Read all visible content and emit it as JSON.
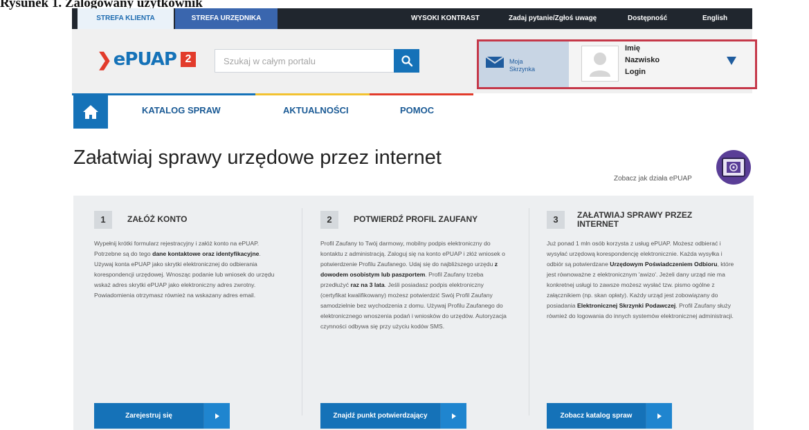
{
  "caption": "Rysunek 1. Zalogowany użytkownik",
  "topbar": {
    "tab_client": "STREFA KLIENTA",
    "tab_official": "STREFA URZĘDNIKA",
    "links": [
      "WYSOKI KONTRAST",
      "Zadaj pytanie/Zgłoś uwagę",
      "Dostępność",
      "English"
    ]
  },
  "header": {
    "logo_text": "ePUAP",
    "logo_badge": "2",
    "search_placeholder": "Szukaj w całym portalu",
    "mailbox_label_1": "Moja",
    "mailbox_label_2": "Skrzynka",
    "user_first": "Imię",
    "user_last": "Nazwisko",
    "user_login": "Login"
  },
  "nav": {
    "items": [
      "KATALOG SPRAW",
      "AKTUALNOŚCI",
      "POMOC"
    ]
  },
  "main": {
    "title": "Załatwiaj sprawy urzędowe przez internet",
    "how_link": "Zobacz jak działa ePUAP"
  },
  "steps": [
    {
      "number": "1",
      "title": "ZAŁÓŻ KONTO",
      "body_1": "Wypełnij krótki formularz rejestracyjny i załóż konto na ePUAP. Potrzebne są do tego ",
      "body_bold_1": "dane kontaktowe oraz identyfikacyjne",
      "body_2": ". Używaj konta ePUAP jako skrytki elektronicznej do odbierania korespondencji urzędowej. Wnosząc podanie lub wniosek do urzędu wskaż adres skrytki ePUAP jako elektroniczny adres zwrotny. Powiadomienia otrzymasz również na wskazany adres email.",
      "button": "Zarejestruj się"
    },
    {
      "number": "2",
      "title": "POTWIERDŹ PROFIL ZAUFANY",
      "body_1": "Profil Zaufany to Twój darmowy, mobilny podpis elektroniczny do kontaktu z administracją. Zaloguj się na konto ePUAP i złóż wniosek o potwierdzenie Profilu Zaufanego. Udaj się do najbliższego urzędu ",
      "body_bold_1": "z dowodem osobistym lub paszportem",
      "body_2": ". Profil Zaufany trzeba przedłużyć ",
      "body_bold_2": "raz na 3 lata",
      "body_3": ". Jeśli posiadasz podpis elektroniczny (certyfikat kwalifikowany) możesz potwierdzić Swój Profil Zaufany samodzielnie bez wychodzenia z domu. Używaj Profilu Zaufanego do elektronicznego wnoszenia podań i wniosków do urzędów. Autoryzacja czynności odbywa się przy użyciu kodów SMS.",
      "button": "Znajdź punkt potwierdzający"
    },
    {
      "number": "3",
      "title_1": "ZAŁATWIAJ SPRAWY PRZEZ",
      "title_2": "INTERNET",
      "body_1": "Już ponad 1 mln osób korzysta z usług ePUAP. Możesz odbierać i wysyłać urzędową korespondencję elektronicznie. Każda wysyłka i odbiór są potwierdzane ",
      "body_bold_1": "Urzędowym Poświadczeniem Odbioru",
      "body_2": ", które jest równoważne z elektronicznym 'awizo'. Jeżeli dany urząd nie ma konkretnej usługi to zawsze możesz wysłać tzw. pismo ogólne z załącznikiem (np. skan opłaty). Każdy urząd jest zobowiązany do posiadania ",
      "body_bold_2": "Elektronicznej Skrzynki Podawczej",
      "body_3": ". Profil Zaufany służy również do logowania do innych systemów elektronicznej administracji.",
      "button": "Zobacz katalog spraw"
    }
  ],
  "colors": {
    "brand_blue": "#1572b8",
    "topbar_dark": "#20262e",
    "highlight_red": "#c53849",
    "stripe_blue": "#1572b8",
    "stripe_yellow": "#f2c230",
    "stripe_red": "#e23b2b"
  },
  "icons": [
    "search-icon",
    "mail-icon",
    "avatar-icon",
    "dropdown-arrow-icon",
    "home-icon",
    "film-icon",
    "arrow-right-icon"
  ]
}
